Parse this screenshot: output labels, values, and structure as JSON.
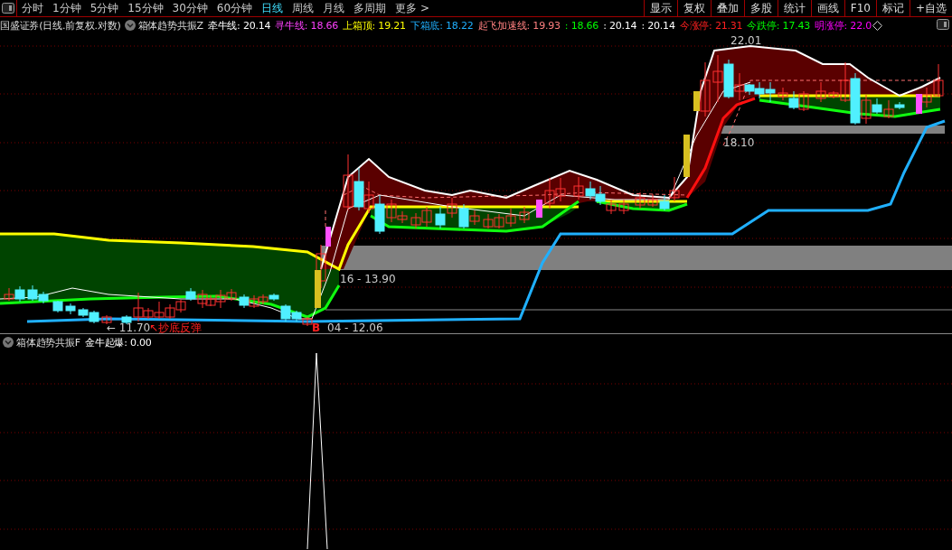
{
  "toolbar": {
    "periods": [
      {
        "label": "分时",
        "selected": false
      },
      {
        "label": "1分钟",
        "selected": false
      },
      {
        "label": "5分钟",
        "selected": false
      },
      {
        "label": "15分钟",
        "selected": false
      },
      {
        "label": "30分钟",
        "selected": false
      },
      {
        "label": "60分钟",
        "selected": false
      },
      {
        "label": "日线",
        "selected": true
      },
      {
        "label": "周线",
        "selected": false
      },
      {
        "label": "月线",
        "selected": false
      },
      {
        "label": "多周期",
        "selected": false
      },
      {
        "label": "更多 >",
        "selected": false
      }
    ],
    "tools": [
      "显示",
      "复权",
      "叠加",
      "多股",
      "统计",
      "画线",
      "F10",
      "标记",
      "+自选"
    ]
  },
  "main_panel": {
    "title": "国盛证券(日线.前复权.对数)",
    "indicator": "箱体趋势共振Z",
    "legend": [
      {
        "text": "牵牛线: 20.14",
        "color": "#ffffff"
      },
      {
        "text": "寻牛线: 18.66",
        "color": "#ff40ff"
      },
      {
        "text": "上箱顶: 19.21",
        "color": "#ffff00"
      },
      {
        "text": "下箱底: 18.22",
        "color": "#20b0ff"
      },
      {
        "text": "起飞加速线: 19.93",
        "color": "#ff8080"
      },
      {
        "text": ": 18.66",
        "color": "#00ff00"
      },
      {
        "text": ": 20.14",
        "color": "#ffffff"
      },
      {
        "text": ": 20.14",
        "color": "#ffffff"
      },
      {
        "text": "今涨停: 21.31",
        "color": "#ff2020"
      },
      {
        "text": "今跌停: 17.43",
        "color": "#00ff00"
      },
      {
        "text": "明涨停: 22.0",
        "color": "#ff00ff"
      }
    ],
    "chart_labels": [
      {
        "text": "22.01",
        "kind": "price"
      },
      {
        "text": "18.10",
        "kind": "price"
      },
      {
        "text": "16 - 13.90",
        "kind": "price"
      },
      {
        "text": "← 11.70",
        "kind": "price"
      },
      {
        "text": "↖抄底反弹",
        "kind": "signal"
      },
      {
        "text": "B",
        "kind": "signal"
      },
      {
        "text": "04 - 12.06",
        "kind": "price"
      }
    ]
  },
  "sub_panel": {
    "indicator": "箱体趋势共振F",
    "legend": [
      {
        "text": "金牛起爆: 0.00",
        "color": "#ffffff"
      }
    ]
  }
}
